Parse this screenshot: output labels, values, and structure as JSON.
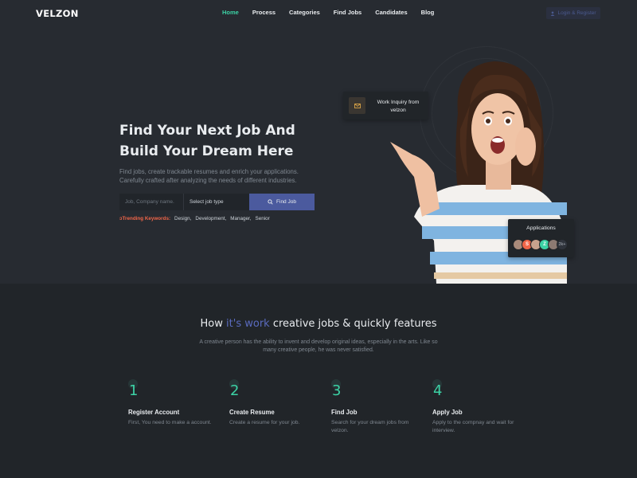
{
  "nav": {
    "logo": "VELZON",
    "items": [
      {
        "label": "Home",
        "active": true
      },
      {
        "label": "Process",
        "active": false
      },
      {
        "label": "Categories",
        "active": false
      },
      {
        "label": "Find Jobs",
        "active": false
      },
      {
        "label": "Candidates",
        "active": false
      },
      {
        "label": "Blog",
        "active": false
      }
    ],
    "login_label": "Login & Register"
  },
  "hero": {
    "title_line1": "Find Your Next Job And",
    "title_line2": "Build Your Dream Here",
    "desc_line1": "Find jobs, create trackable resumes and enrich your applications.",
    "desc_line2": "Carefully crafted after analyzing the needs of different industries.",
    "search_placeholder": "Job, Company name.",
    "job_type_value": "Select job type",
    "find_button": "Find Job",
    "trending_label": "Trending Keywords:",
    "keywords": [
      "Design,",
      "Development,",
      "Manager,",
      "Senior"
    ],
    "inquiry_text": "Work Inquiry from velzon",
    "applications_title": "Applications",
    "applications_more": "2k+"
  },
  "how": {
    "title_pre": "How",
    "title_hl": "it's work",
    "title_post": "creative jobs & quickly features",
    "desc_line1": "A creative person has the ability to invent and develop original ideas, especially in the arts. Like so",
    "desc_line2": "many creative people, he was never satisfied.",
    "steps": [
      {
        "num": "1",
        "title": "Register Account",
        "desc": "First, You need to make a account."
      },
      {
        "num": "2",
        "title": "Create Resume",
        "desc": "Create a resume for your job."
      },
      {
        "num": "3",
        "title": "Find Job",
        "desc": "Search for your dream jobs from velzon."
      },
      {
        "num": "4",
        "title": "Apply Job",
        "desc": "Apply to the compnay and wait for interview."
      }
    ]
  },
  "colors": {
    "accent": "#3cd2a5",
    "primary": "#4b5a9e",
    "danger": "#f06548",
    "warning": "#f7b84b"
  },
  "icons": [
    "mail-icon",
    "search-icon",
    "fire-icon",
    "user-icon"
  ]
}
